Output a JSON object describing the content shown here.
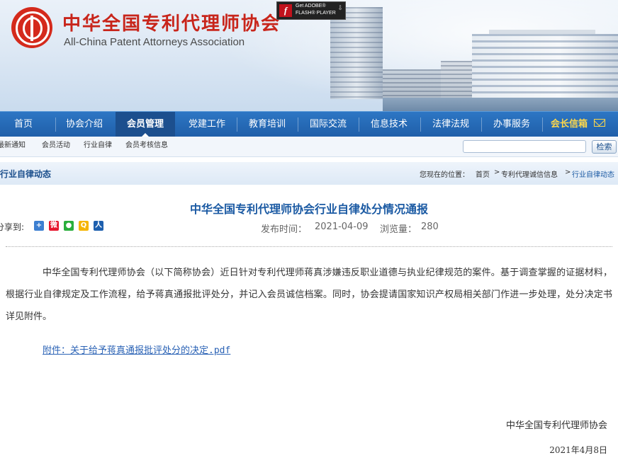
{
  "header": {
    "org_name_cn": "中华全国专利代理师协会",
    "org_name_en": "All-China Patent Attorneys Association",
    "flash_badge": {
      "line1": "Get ADOBE®",
      "line2": "FLASH® PLAYER"
    }
  },
  "nav": {
    "items": [
      "首页",
      "协会介绍",
      "会员管理",
      "党建工作",
      "教育培训",
      "国际交流",
      "信息技术",
      "法律法规",
      "办事服务"
    ],
    "active": "会员管理",
    "mailbox": "会长信箱"
  },
  "subnav": {
    "items": [
      "最新通知",
      "会员活动",
      "行业自律",
      "会员考核信息"
    ],
    "search_value": "",
    "search_button": "检索"
  },
  "section": {
    "title": "行业自律动态",
    "breadcrumb_prefix": "您现在的位置：",
    "breadcrumb": [
      "首页",
      "专利代理诚信信息",
      "行业自律动态"
    ],
    "separator": ">"
  },
  "article": {
    "title": "中华全国专利代理师协会行业自律处分情况通报",
    "share_label": "分享到:",
    "share_icons": [
      "qzone-icon",
      "weibo-icon",
      "wechat-icon",
      "qq-icon",
      "renren-icon"
    ],
    "publish_label": "发布时间：",
    "publish_date": "2021-04-09",
    "views_label": "浏览量：",
    "views": "280",
    "body": "中华全国专利代理师协会（以下简称协会）近日针对专利代理师蒋真涉嫌违反职业道德与执业纪律规范的案件。基于调查掌握的证据材料，根据行业自律规定及工作流程，给予蒋真通报批评处分，并记入会员诚信档案。同时，协会提请国家知识产权局相关部门作进一步处理，处分决定书详见附件。",
    "attachment": "附件：关于给予蒋真通报批评处分的决定.pdf",
    "signature_org": "中华全国专利代理师协会",
    "signature_date": "2021年4月8日"
  },
  "colors": {
    "nav_blue": "#2d76c4",
    "nav_active": "#1c4f8e",
    "title_blue": "#1b5aa3",
    "brand_red": "#c8251b",
    "mailbox_yellow": "#ffd84a"
  }
}
